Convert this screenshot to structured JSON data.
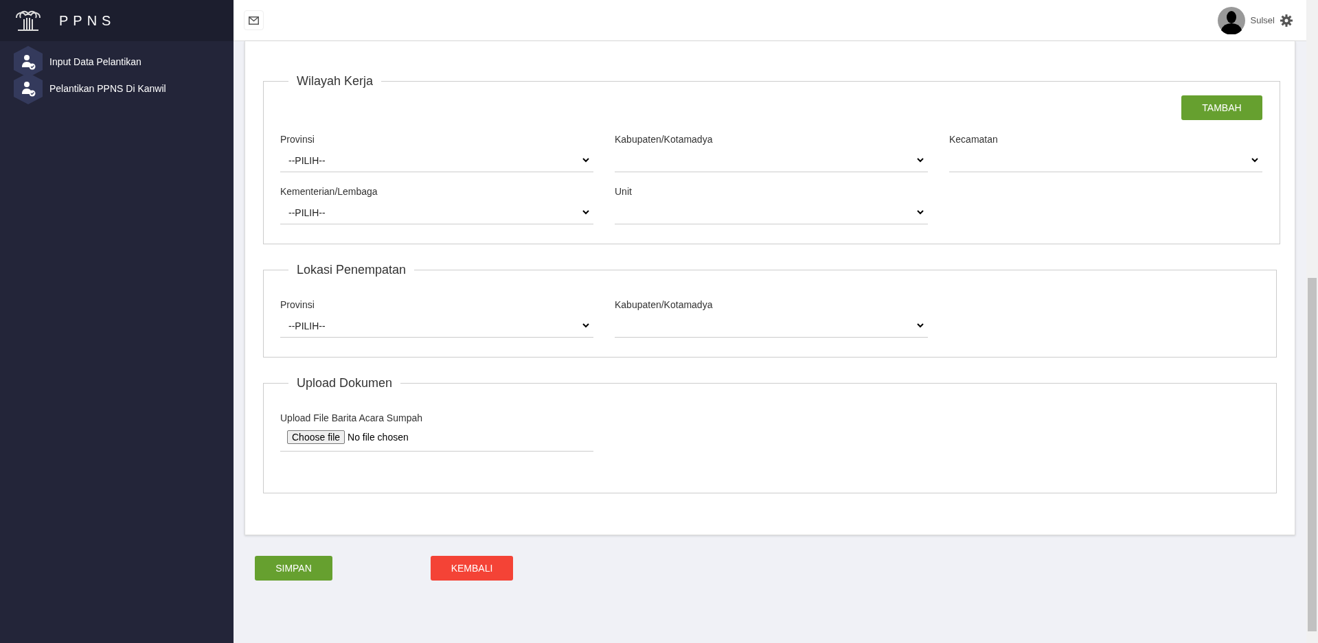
{
  "brand": "PPNS",
  "sidebar": {
    "items": [
      {
        "label": "Input Data Pelantikan"
      },
      {
        "label": "Pelantikan PPNS Di Kanwil"
      }
    ]
  },
  "header": {
    "user": "Sulsel"
  },
  "sections": [
    {
      "title": "Wilayah Kerja",
      "button": "TAMBAH",
      "rows": [
        [
          {
            "kind": "select",
            "label": "Provinsi",
            "value": "--PILIH--"
          },
          {
            "kind": "select",
            "label": "Kabupaten/Kotamadya"
          },
          {
            "kind": "select",
            "label": "Kecamatan"
          }
        ],
        [
          {
            "kind": "select",
            "label": "Kementerian/Lembaga",
            "value": "--PILIH--"
          },
          {
            "kind": "select",
            "label": "Unit"
          }
        ]
      ]
    },
    {
      "title": "Lokasi Penempatan",
      "rows": [
        [
          {
            "kind": "select",
            "label": "Provinsi",
            "value": "--PILIH--"
          },
          {
            "kind": "select",
            "label": "Kabupaten/Kotamadya"
          }
        ]
      ]
    },
    {
      "title": "Upload Dokumen",
      "rows": [
        [
          {
            "kind": "file",
            "label": "Upload File Barita Acara Sumpah",
            "button": "Choose file",
            "value": "No file chosen"
          }
        ]
      ]
    }
  ],
  "actions": [
    {
      "label": "SIMPAN",
      "kind": "primary"
    },
    {
      "label": "KEMBALI",
      "kind": "danger"
    }
  ]
}
